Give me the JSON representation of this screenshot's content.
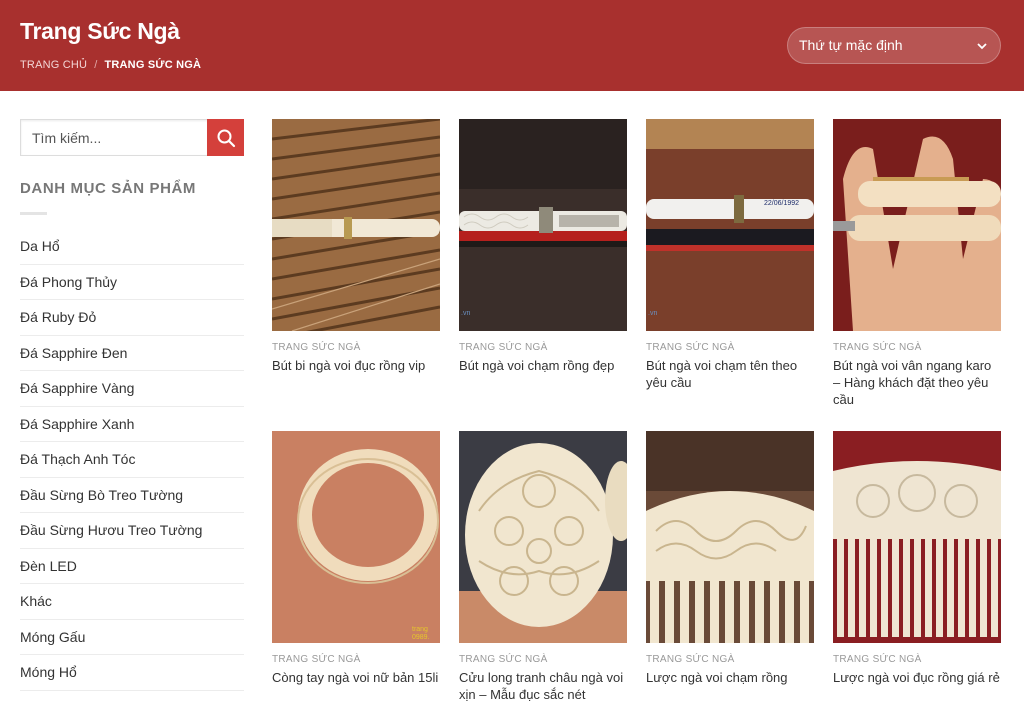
{
  "header": {
    "title": "Trang Sức Ngà",
    "breadcrumb": {
      "home": "TRANG CHỦ",
      "separator": "/",
      "current": "TRANG SỨC NGÀ"
    },
    "sort": {
      "value": "Thứ tự mặc định"
    },
    "bg_color": "#a8302e"
  },
  "sidebar": {
    "search": {
      "placeholder": "Tìm kiếm..."
    },
    "categories_title": "DANH MỤC SẢN PHẨM",
    "categories": [
      "Da Hổ",
      "Đá Phong Thủy",
      "Đá Ruby Đỏ",
      "Đá Sapphire Đen",
      "Đá Sapphire Vàng",
      "Đá Sapphire Xanh",
      "Đá Thạch Anh Tóc",
      "Đầu Sừng Bò Treo Tường",
      "Đầu Sừng Hươu Treo Tường",
      "Đèn LED",
      "Khác",
      "Móng Gấu",
      "Móng Hổ"
    ]
  },
  "products": [
    {
      "category": "TRANG SỨC NGÀ",
      "name": "Bút bi ngà voi đục rồng vip"
    },
    {
      "category": "TRANG SỨC NGÀ",
      "name": "Bút ngà voi chạm rồng đẹp"
    },
    {
      "category": "TRANG SỨC NGÀ",
      "name": "Bút ngà voi chạm tên theo yêu cầu"
    },
    {
      "category": "TRANG SỨC NGÀ",
      "name": "Bút ngà voi vân ngang karo – Hàng khách đặt theo yêu cầu"
    },
    {
      "category": "TRANG SỨC NGÀ",
      "name": "Còng tay ngà voi nữ bản 15li"
    },
    {
      "category": "TRANG SỨC NGÀ",
      "name": "Cửu long tranh châu ngà voi xịn – Mẫu đục sắc nét"
    },
    {
      "category": "TRANG SỨC NGÀ",
      "name": "Lược ngà voi chạm rồng"
    },
    {
      "category": "TRANG SỨC NGÀ",
      "name": "Lược ngà voi đục rồng giá rẻ"
    }
  ],
  "photo_overlays": {
    "pen_engraving": "22/06/1992",
    "watermark_1": "trang",
    "watermark_2": "0989.",
    "watermark_3": ".vn"
  }
}
